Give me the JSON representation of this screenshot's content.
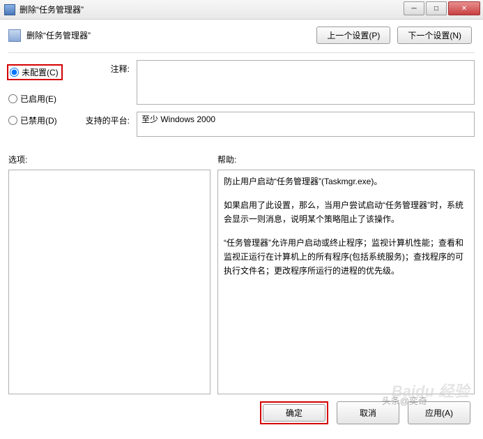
{
  "window": {
    "title": "删除“任务管理器”"
  },
  "header": {
    "title": "删除“任务管理器”",
    "prev_btn": "上一个设置(P)",
    "next_btn": "下一个设置(N)"
  },
  "radios": {
    "not_configured": "未配置(C)",
    "enabled": "已启用(E)",
    "disabled": "已禁用(D)",
    "selected": "not_configured"
  },
  "form": {
    "comment_label": "注释:",
    "comment_value": "",
    "platform_label": "支持的平台:",
    "platform_value": "至少 Windows 2000"
  },
  "sections": {
    "options_label": "选项:",
    "help_label": "帮助:"
  },
  "help": {
    "p1": "防止用户启动“任务管理器”(Taskmgr.exe)。",
    "p2": "如果启用了此设置，那么，当用户尝试启动“任务管理器”时，系统会显示一则消息，说明某个策略阻止了该操作。",
    "p3": "“任务管理器”允许用户启动或终止程序；监视计算机性能；查看和监视正运行在计算机上的所有程序(包括系统服务)；查找程序的可执行文件名；更改程序所运行的进程的优先级。"
  },
  "footer": {
    "ok": "确定",
    "cancel": "取消",
    "apply": "应用(A)"
  },
  "watermark": {
    "brand": "Baidu 经验",
    "attrib": "头条@奕奇"
  }
}
